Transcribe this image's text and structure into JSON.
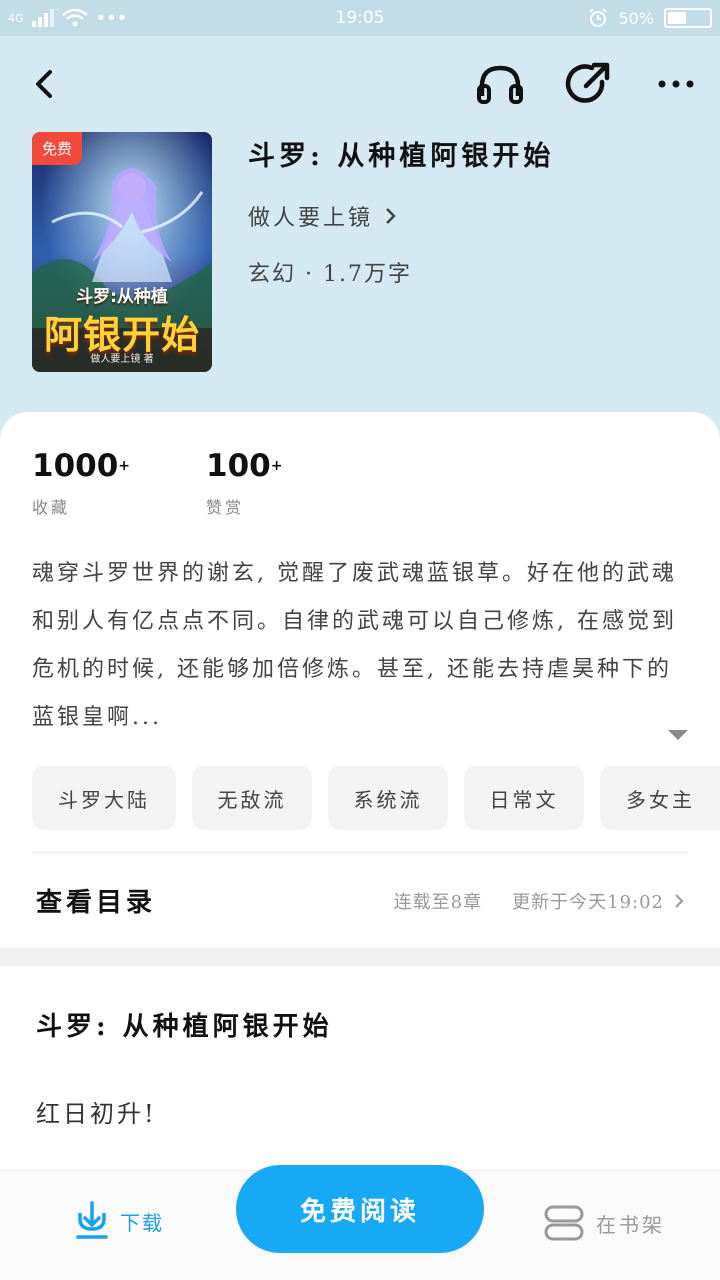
{
  "status_bar": {
    "network": "4G",
    "time": "19:05",
    "battery": "50%",
    "battery_level": 0.5
  },
  "book": {
    "cover_badge": "免费",
    "cover_subtitle": "斗罗:从种植",
    "cover_title": "阿银开始",
    "cover_author": "做人要上镜 著",
    "title": "斗罗: 从种植阿银开始",
    "author": "做人要上镜",
    "meta": "玄幻 · 1.7万字"
  },
  "stats": [
    {
      "value": "1000",
      "suffix": "+",
      "label": "收藏"
    },
    {
      "value": "100",
      "suffix": "+",
      "label": "赞赏"
    }
  ],
  "summary": "魂穿斗罗世界的谢玄, 觉醒了废武魂蓝银草。好在他的武魂和别人有亿点点不同。自律的武魂可以自己修炼, 在感觉到危机的时候, 还能够加倍修炼。甚至, 还能去持虐昊种下的蓝银皇啊...",
  "tags": [
    "斗罗大陆",
    "无敌流",
    "系统流",
    "日常文",
    "多女主"
  ],
  "toc": {
    "label": "查看目录",
    "chapters": "连载至8章",
    "updated": "更新于今天19:02"
  },
  "preview": {
    "chapter_title": "斗罗: 从种植阿银开始",
    "first_line": "红日初升!"
  },
  "bottom_bar": {
    "download": "下载",
    "read": "免费阅读",
    "shelf": "在书架"
  },
  "colors": {
    "accent": "#17a9f4",
    "header_bg": "#d5e9f2",
    "badge": "#f24a3a"
  }
}
